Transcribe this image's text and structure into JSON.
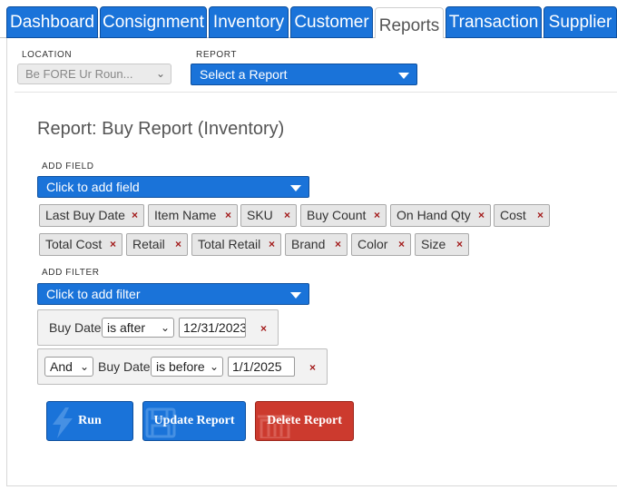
{
  "tabs": [
    {
      "label": "Dashboard",
      "active": false
    },
    {
      "label": "Consignment",
      "active": false
    },
    {
      "label": "Inventory",
      "active": false
    },
    {
      "label": "Customer",
      "active": false
    },
    {
      "label": "Reports",
      "active": true
    },
    {
      "label": "Transaction",
      "active": false
    },
    {
      "label": "Supplier",
      "active": false
    }
  ],
  "location": {
    "label": "LOCATION",
    "value": "Be FORE Ur Roun..."
  },
  "report": {
    "label": "REPORT",
    "value": "Select a Report"
  },
  "report_title": "Report: Buy Report (Inventory)",
  "add_field": {
    "label": "ADD FIELD",
    "placeholder": "Click to add field",
    "fields": [
      "Last Buy Date",
      "Item Name",
      "SKU",
      "Buy Count",
      "On Hand Qty",
      "Cost",
      "Total Cost",
      "Retail",
      "Total Retail",
      "Brand",
      "Color",
      "Size"
    ]
  },
  "add_filter": {
    "label": "ADD FILTER",
    "placeholder": "Click to add filter",
    "filters": [
      {
        "field": "Buy Date",
        "operator": "is after",
        "value": "12/31/2023"
      },
      {
        "join": "And",
        "field": "Buy Date",
        "operator": "is before",
        "value": "1/1/2025"
      }
    ],
    "remove": "×"
  },
  "buttons": {
    "run": "Run",
    "update": "Update Report",
    "delete": "Delete Report"
  },
  "chip_remove": "×",
  "colors": {
    "primary": "#1a73d9",
    "danger": "#cc3a2e",
    "remove": "#a31c1c"
  }
}
